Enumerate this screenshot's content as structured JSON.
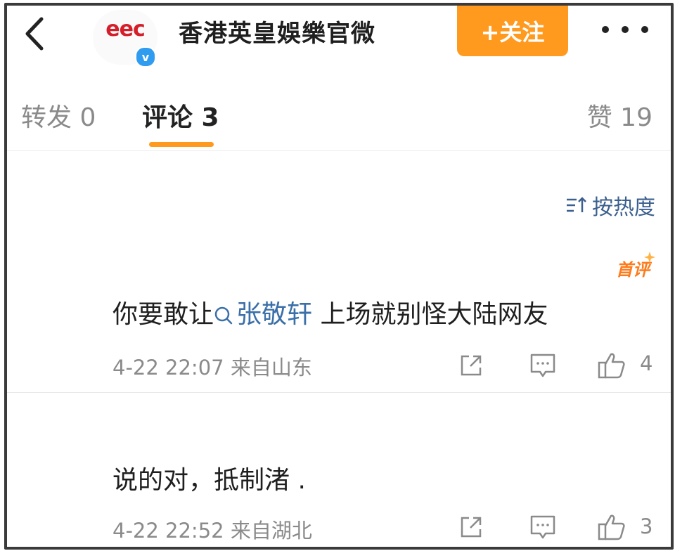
{
  "header": {
    "logo_text": "eec",
    "verified_mark": "v",
    "account_name": "香港英皇娛樂官微",
    "follow_label": "+关注",
    "back_icon": "chevron-left-icon",
    "more_icon": "more-dots-icon"
  },
  "tabs": {
    "repost": "转发 0",
    "comments": "评论 3",
    "likes": "赞 19"
  },
  "sort": {
    "label": "按热度",
    "icon": "sort-icon"
  },
  "comments": [
    {
      "badge": "首评",
      "text_before": "你要敢让",
      "mention": "张敬轩",
      "text_after": " 上场就别怪大陆网友",
      "meta": "4-22 22:07  来自山东",
      "likes": "4"
    },
    {
      "text": "说的对，抵制渚   .",
      "meta": "4-22 22:52  来自湖北",
      "likes": "3"
    }
  ],
  "colors": {
    "accent": "#ff9a1f",
    "link": "#3b6fa8",
    "verified": "#2f9cf0",
    "brand_red": "#d41f2a"
  }
}
